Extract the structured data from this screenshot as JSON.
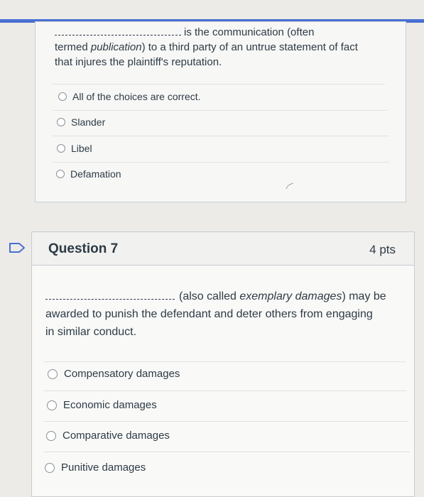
{
  "colors": {
    "accent_bar": "#4a6fd1",
    "text": "#2d3b45",
    "background": "#ecebe8"
  },
  "question6": {
    "text_after_blank": "is the communication (often",
    "text_line2_prefix": "termed ",
    "text_line2_italic": "publication",
    "text_line2_suffix": ") to a third party of an untrue statement of fact",
    "text_line3": "that injures the plaintiff's reputation.",
    "answers": [
      {
        "label": "All of the choices are correct."
      },
      {
        "label": "Slander"
      },
      {
        "label": "Libel"
      },
      {
        "label": "Defamation"
      }
    ]
  },
  "question7": {
    "title": "Question 7",
    "points": "4 pts",
    "text_before_italic": "(also called ",
    "text_italic": "exemplary damages",
    "text_after_italic": ") may be",
    "text_line2": "awarded to punish the defendant and deter others from engaging",
    "text_line3": "in similar conduct.",
    "answers": [
      {
        "label": "Compensatory damages"
      },
      {
        "label": "Economic damages"
      },
      {
        "label": "Comparative damages"
      },
      {
        "label": "Punitive damages"
      }
    ]
  }
}
